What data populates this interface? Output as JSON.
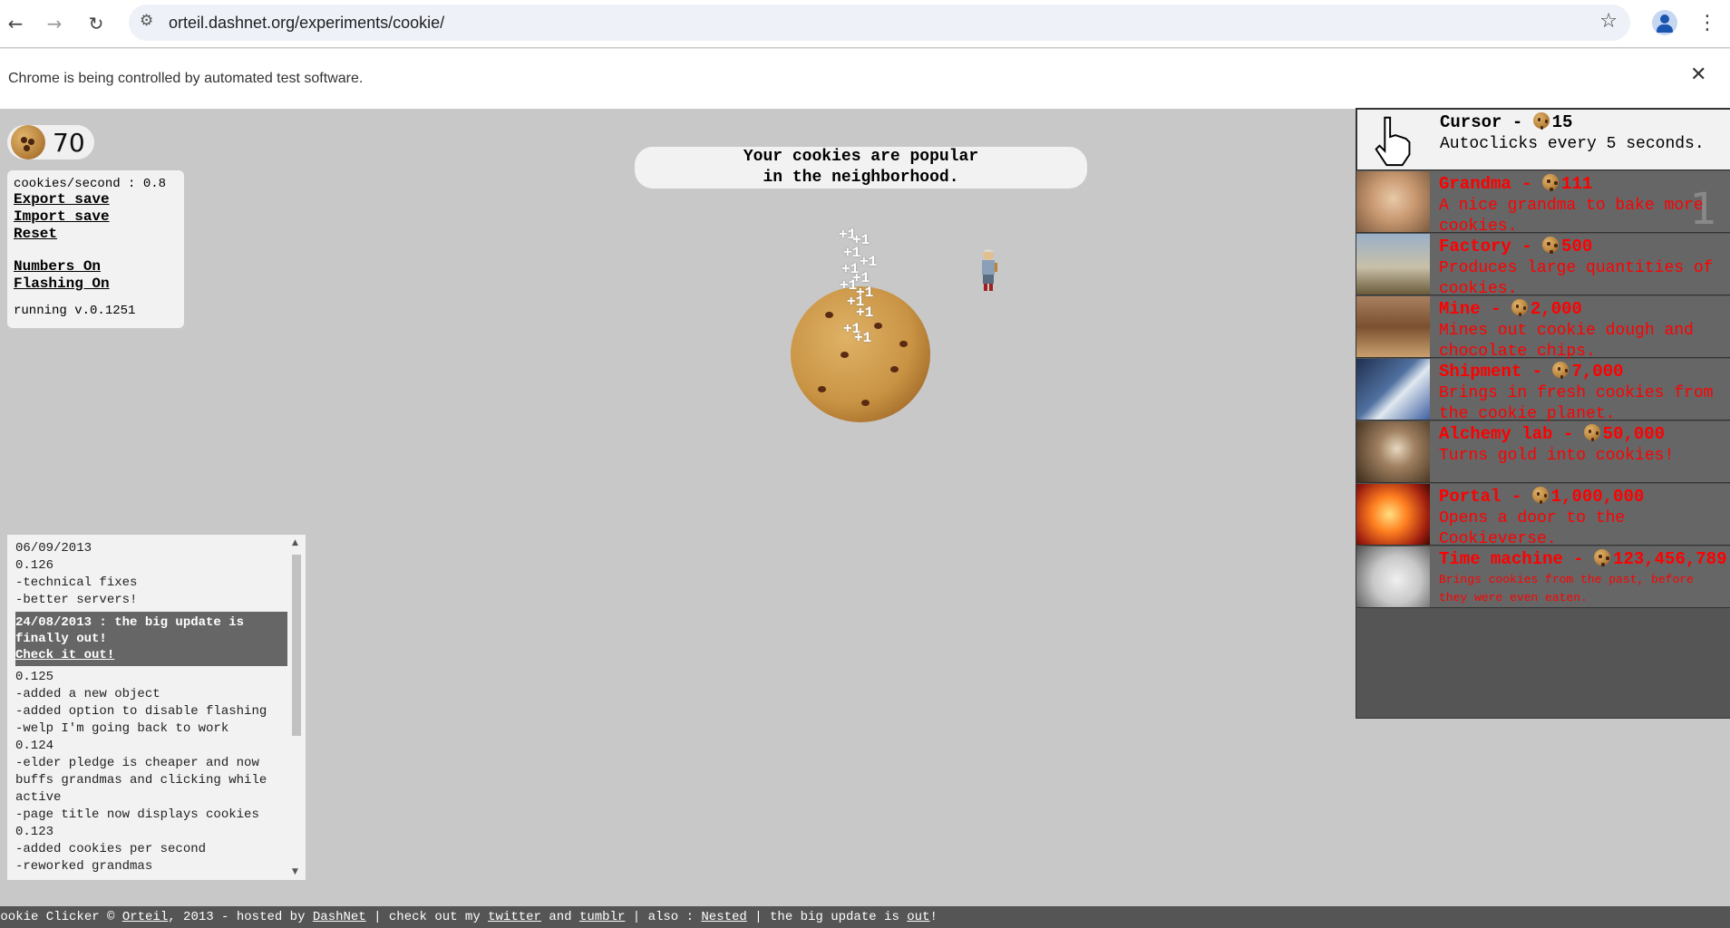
{
  "browser": {
    "url": "orteil.dashnet.org/experiments/cookie/",
    "infobar_text": "Chrome is being controlled by automated test software."
  },
  "game": {
    "cookie_count": "70",
    "stats": {
      "cps": "cookies/second : 0.8",
      "export": "Export save",
      "import": "Import save",
      "reset": "Reset",
      "numbers": "Numbers On",
      "flashing": "Flashing On",
      "version": "running v.0.1251"
    },
    "news": "Your cookies are popular\nin the neighborhood.",
    "plus_one_text": "+1",
    "changelog": {
      "lines_top": [
        "06/09/2013",
        "0.126",
        "-technical fixes",
        "-better servers!"
      ],
      "highlight_line1": "24/08/2013 : the big update is finally out!",
      "highlight_link": "Check it out!",
      "lines_bottom": [
        "0.125",
        "-added a new object",
        "-added option to disable flashing",
        "-welp I'm going back to work",
        "0.124",
        "-elder pledge is cheaper and now buffs grandmas and clicking while active",
        "-page title now displays cookies",
        "0.123",
        "-added cookies per second",
        "-reworked grandmas"
      ]
    },
    "store": [
      {
        "name": "Cursor",
        "price": "15",
        "desc": "Autoclicks every 5 seconds.",
        "icon": "cursor-icon"
      },
      {
        "name": "Grandma",
        "price": "111",
        "desc": "A nice grandma to bake more cookies.",
        "icon": "grandma-icon",
        "owned": "1"
      },
      {
        "name": "Factory",
        "price": "500",
        "desc": "Produces large quantities of cookies.",
        "icon": "factory-icon"
      },
      {
        "name": "Mine",
        "price": "2,000",
        "desc": "Mines out cookie dough and chocolate chips.",
        "icon": "mine-icon"
      },
      {
        "name": "Shipment",
        "price": "7,000",
        "desc": "Brings in fresh cookies from the cookie planet.",
        "icon": "shipment-icon"
      },
      {
        "name": "Alchemy lab",
        "price": "50,000",
        "desc": "Turns gold into cookies!",
        "icon": "alchemy-lab-icon"
      },
      {
        "name": "Portal",
        "price": "1,000,000",
        "desc": "Opens a door to the Cookieverse.",
        "icon": "portal-icon"
      },
      {
        "name": "Time machine",
        "price": "123,456,789",
        "desc": "Brings cookies from the past, before they were even eaten.",
        "icon": "time-machine-icon"
      }
    ],
    "footer": {
      "p1": "Cookie Clicker © ",
      "orteil": "Orteil",
      "p2": ", 2013 - hosted by ",
      "dashnet": "DashNet",
      "p3": " | check out my ",
      "twitter": "twitter",
      "p4": " and ",
      "tumblr": "tumblr",
      "p5": " | also : ",
      "nested": "Nested",
      "p6": " | the big update is ",
      "out": "out",
      "p7": "!"
    }
  }
}
